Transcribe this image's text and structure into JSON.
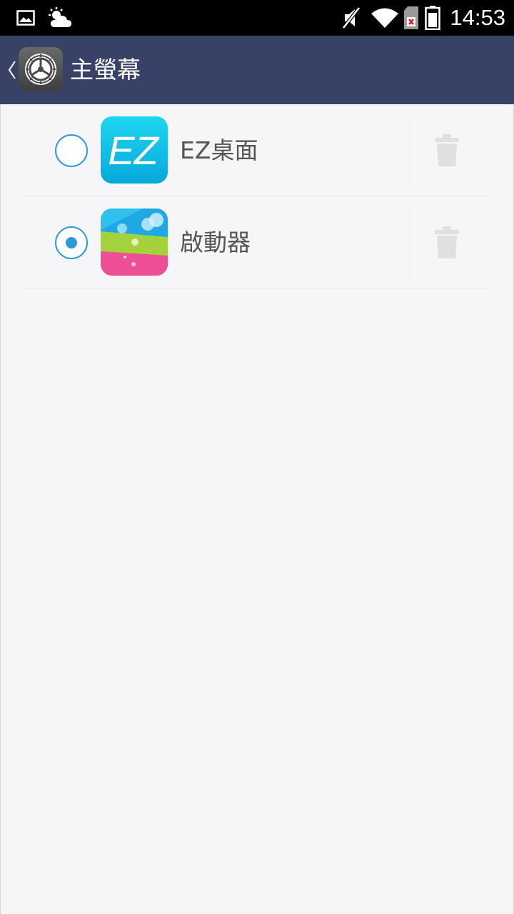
{
  "status_bar": {
    "time": "14:53",
    "icons": [
      "picture-icon",
      "weather-partly-cloudy-icon",
      "mute-icon",
      "wifi-icon",
      "no-sim-icon",
      "battery-icon"
    ]
  },
  "action_bar": {
    "title": "主螢幕",
    "back_icon": "chevron-left-icon",
    "app_icon": "settings-gear-icon",
    "background": "#384266"
  },
  "launchers": [
    {
      "label": "EZ桌面",
      "icon_text": "EZ",
      "selected": false,
      "icon": "ez-launcher-icon"
    },
    {
      "label": "啟動器",
      "selected": true,
      "icon": "launcher-icon"
    }
  ],
  "colors": {
    "accent": "#2d9ad8",
    "background": "#f6f6f8"
  }
}
